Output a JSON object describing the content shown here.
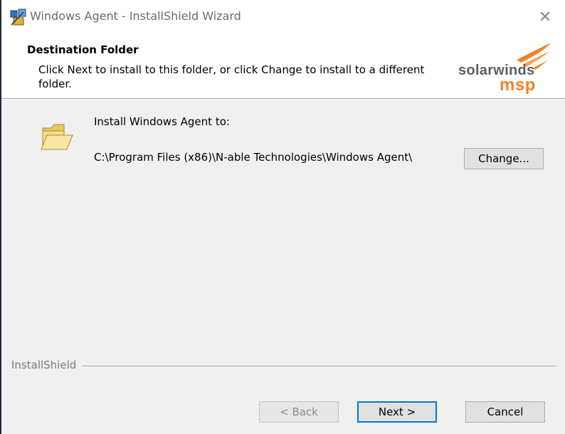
{
  "window": {
    "title": "Windows Agent - InstallShield Wizard",
    "close_glyph": "✕"
  },
  "header": {
    "title": "Destination Folder",
    "description": "Click Next to install to this folder, or click Change to install to a different folder.",
    "logo": {
      "word1": "solarwinds",
      "word2": "msp",
      "accent_color": "#f58220"
    }
  },
  "main": {
    "install_label": "Install Windows Agent to:",
    "install_path": "C:\\Program Files (x86)\\N-able Technologies\\Windows Agent\\",
    "change_button": "Change..."
  },
  "footer": {
    "brand": "InstallShield",
    "back_button": "< Back",
    "next_button": "Next >",
    "cancel_button": "Cancel"
  },
  "colors": {
    "dialog_background": "#f0f0f0",
    "focus_border": "#0078d7"
  }
}
